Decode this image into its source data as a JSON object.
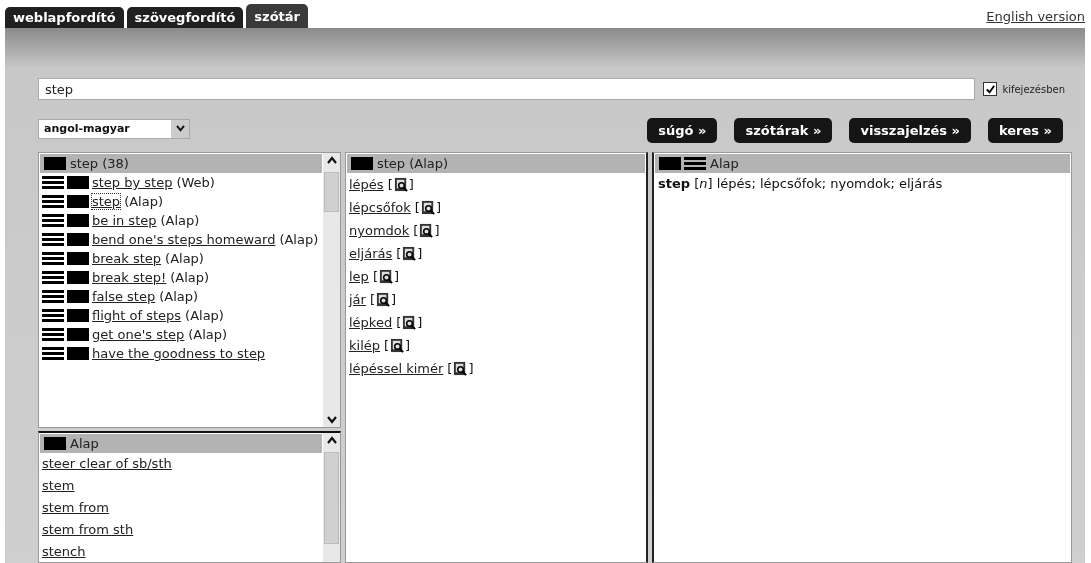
{
  "tabs": [
    {
      "label": "weblapfordító",
      "selected": false
    },
    {
      "label": "szövegfordító",
      "selected": false
    },
    {
      "label": "szótár",
      "selected": true
    }
  ],
  "language_link": "English version",
  "search": {
    "value": "step"
  },
  "phrase_option": {
    "label": "kifejezésben",
    "checked": true
  },
  "language_select": {
    "value": "angol-magyar"
  },
  "buttons": [
    "súgó »",
    "szótárak »",
    "visszajelzés »",
    "keres »"
  ],
  "results_list": {
    "title": "step (38)",
    "items": [
      {
        "phrase": "step by step",
        "source": "(Web)",
        "selected": false
      },
      {
        "phrase": "step",
        "source": "(Alap)",
        "selected": true
      },
      {
        "phrase": "be in step",
        "source": "(Alap)",
        "selected": false
      },
      {
        "phrase": "bend one's steps homeward",
        "source": "(Alap)",
        "selected": false
      },
      {
        "phrase": "break step",
        "source": "(Alap)",
        "selected": false
      },
      {
        "phrase": "break step!",
        "source": "(Alap)",
        "selected": false
      },
      {
        "phrase": "false step",
        "source": "(Alap)",
        "selected": false
      },
      {
        "phrase": "flight of steps",
        "source": "(Alap)",
        "selected": false
      },
      {
        "phrase": "get one's step",
        "source": "(Alap)",
        "selected": false
      },
      {
        "phrase": "have the goodness to step",
        "selected": false
      }
    ]
  },
  "nearby_list": {
    "title": "Alap",
    "items": [
      "steer clear of sb/sth",
      "stem",
      "stem from",
      "stem from sth",
      "stench"
    ]
  },
  "translations": {
    "title": "step (Alap)",
    "items": [
      {
        "word": "lépés",
        "open": "[",
        "close": "]"
      },
      {
        "word": "lépcsőfok",
        "open": "[",
        "close": "]"
      },
      {
        "word": "nyomdok",
        "open": "[",
        "close": "]"
      },
      {
        "word": "eljárás",
        "open": "[",
        "close": "]"
      },
      {
        "word": "lep",
        "open": "[",
        "close": "]"
      },
      {
        "word": "jár",
        "open": "[",
        "close": "]"
      },
      {
        "word": "lépked",
        "open": "[",
        "close": "]"
      },
      {
        "word": "kilép",
        "open": "[",
        "close": "]"
      },
      {
        "word": "lépéssel kimér",
        "open": "[",
        "close": "]"
      }
    ]
  },
  "entry": {
    "title": "Alap",
    "text": "**step** [*n*] lépés; lépcsőfok; nyomdok; eljárás"
  }
}
